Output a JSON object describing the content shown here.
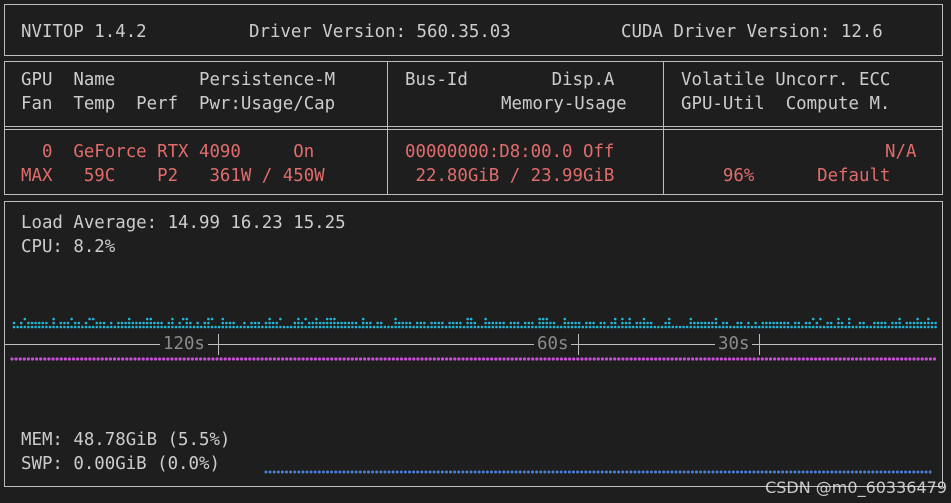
{
  "header": {
    "app": "NVITOP 1.4.2",
    "driver": "Driver Version: 560.35.03",
    "cuda": "CUDA Driver Version: 12.6"
  },
  "table_header": {
    "col1_row1": "GPU  Name        Persistence-M",
    "col1_row2": "Fan  Temp  Perf  Pwr:Usage/Cap",
    "col2_row1": "Bus-Id        Disp.A",
    "col2_row2": "Memory-Usage",
    "col3_row1": "Volatile Uncorr. ECC",
    "col3_row2": "GPU-Util  Compute M."
  },
  "gpu": {
    "col1_row1": "  0  GeForce RTX 4090     On",
    "col1_row2": "MAX   59C    P2   361W / 450W",
    "col2_row1": "00000000:D8:00.0 Off",
    "col2_row2": " 22.80GiB / 23.99GiB",
    "col3_row1": "N/A",
    "col3_row2": "    96%      Default"
  },
  "host": {
    "load": "Load Average: 14.99 16.23 15.25",
    "cpu": "CPU: 8.2%",
    "mem": "MEM: 48.78GiB (5.5%)",
    "swp": "SWP: 0.00GiB (0.0%)"
  },
  "timeline": {
    "t120": "120s",
    "t60": "60s",
    "t30": "30s"
  },
  "colors": {
    "cpu_dots": "#1fb8d8",
    "mem_dots": "#c74fd6",
    "swp_dots": "#4a7fd9",
    "gpu_text": "#e06c6c"
  },
  "watermark": "CSDN @m0_60336479"
}
